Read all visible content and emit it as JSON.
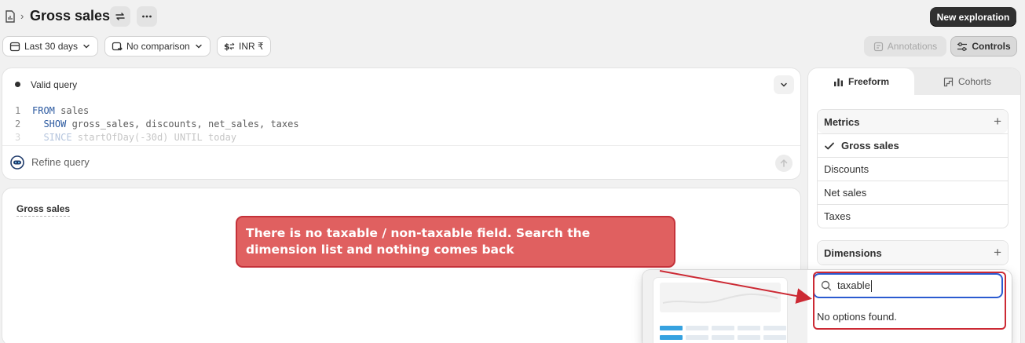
{
  "header": {
    "title": "Gross sales",
    "new_button": "New exploration"
  },
  "filters": {
    "date_range": "Last 30 days",
    "comparison": "No comparison",
    "currency": "INR ₹"
  },
  "toolbar": {
    "annotations": "Annotations",
    "controls": "Controls"
  },
  "query": {
    "status": "Valid query",
    "lines": [
      {
        "n": "1",
        "kw": "FROM",
        "rest": " sales"
      },
      {
        "n": "2",
        "kw": "  SHOW",
        "rest": " gross_sales, discounts, net_sales, taxes"
      },
      {
        "n": "3",
        "kw": "  SINCE",
        "rest": " startOfDay(-30d) UNTIL today"
      }
    ],
    "refine_placeholder": "Refine query"
  },
  "chart": {
    "title": "Gross sales"
  },
  "annotation_callout": {
    "line1": "There is no taxable / non-taxable field. Search the",
    "line2": "dimension list and nothing comes back"
  },
  "side_panel": {
    "tabs": [
      "Freeform",
      "Cohorts"
    ],
    "metrics_header": "Metrics",
    "metrics": [
      "Gross sales",
      "Discounts",
      "Net sales",
      "Taxes"
    ],
    "selected_metric": "Gross sales",
    "dimensions_header": "Dimensions"
  },
  "dimension_search": {
    "value": "taxable",
    "empty_message": "No options found."
  },
  "colors": {
    "primary_button": "#303030",
    "callout_fill": "#e06060",
    "callout_border": "#c4323a",
    "highlight_red": "#cc2a34",
    "focus_blue": "#2b5bd0"
  }
}
